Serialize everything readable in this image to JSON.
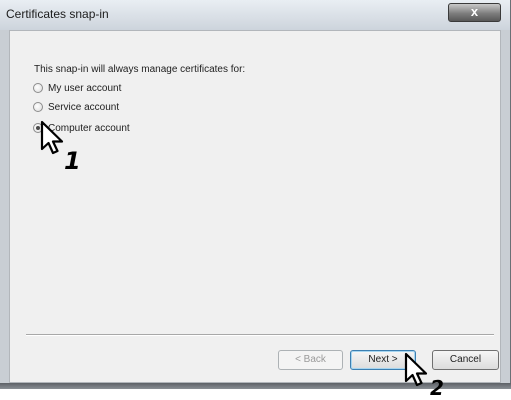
{
  "window": {
    "title": "Certificates snap-in",
    "close_symbol": "x"
  },
  "dialog": {
    "instruction": "This snap-in will always manage certificates for:",
    "options": [
      {
        "label": "My user account",
        "selected": false
      },
      {
        "label": "Service account",
        "selected": false
      },
      {
        "label": "Computer account",
        "selected": true
      }
    ]
  },
  "buttons": {
    "back": "< Back",
    "next": "Next >",
    "cancel": "Cancel",
    "back_enabled": false
  },
  "annotations": {
    "step1": "1",
    "step2": "2"
  },
  "icons": {
    "cursor": "mouse-pointer-icon"
  },
  "colors": {
    "dialog_background": "#f0f0f0",
    "frame": "#c9ced4",
    "focus_border": "#3c7fb1"
  }
}
